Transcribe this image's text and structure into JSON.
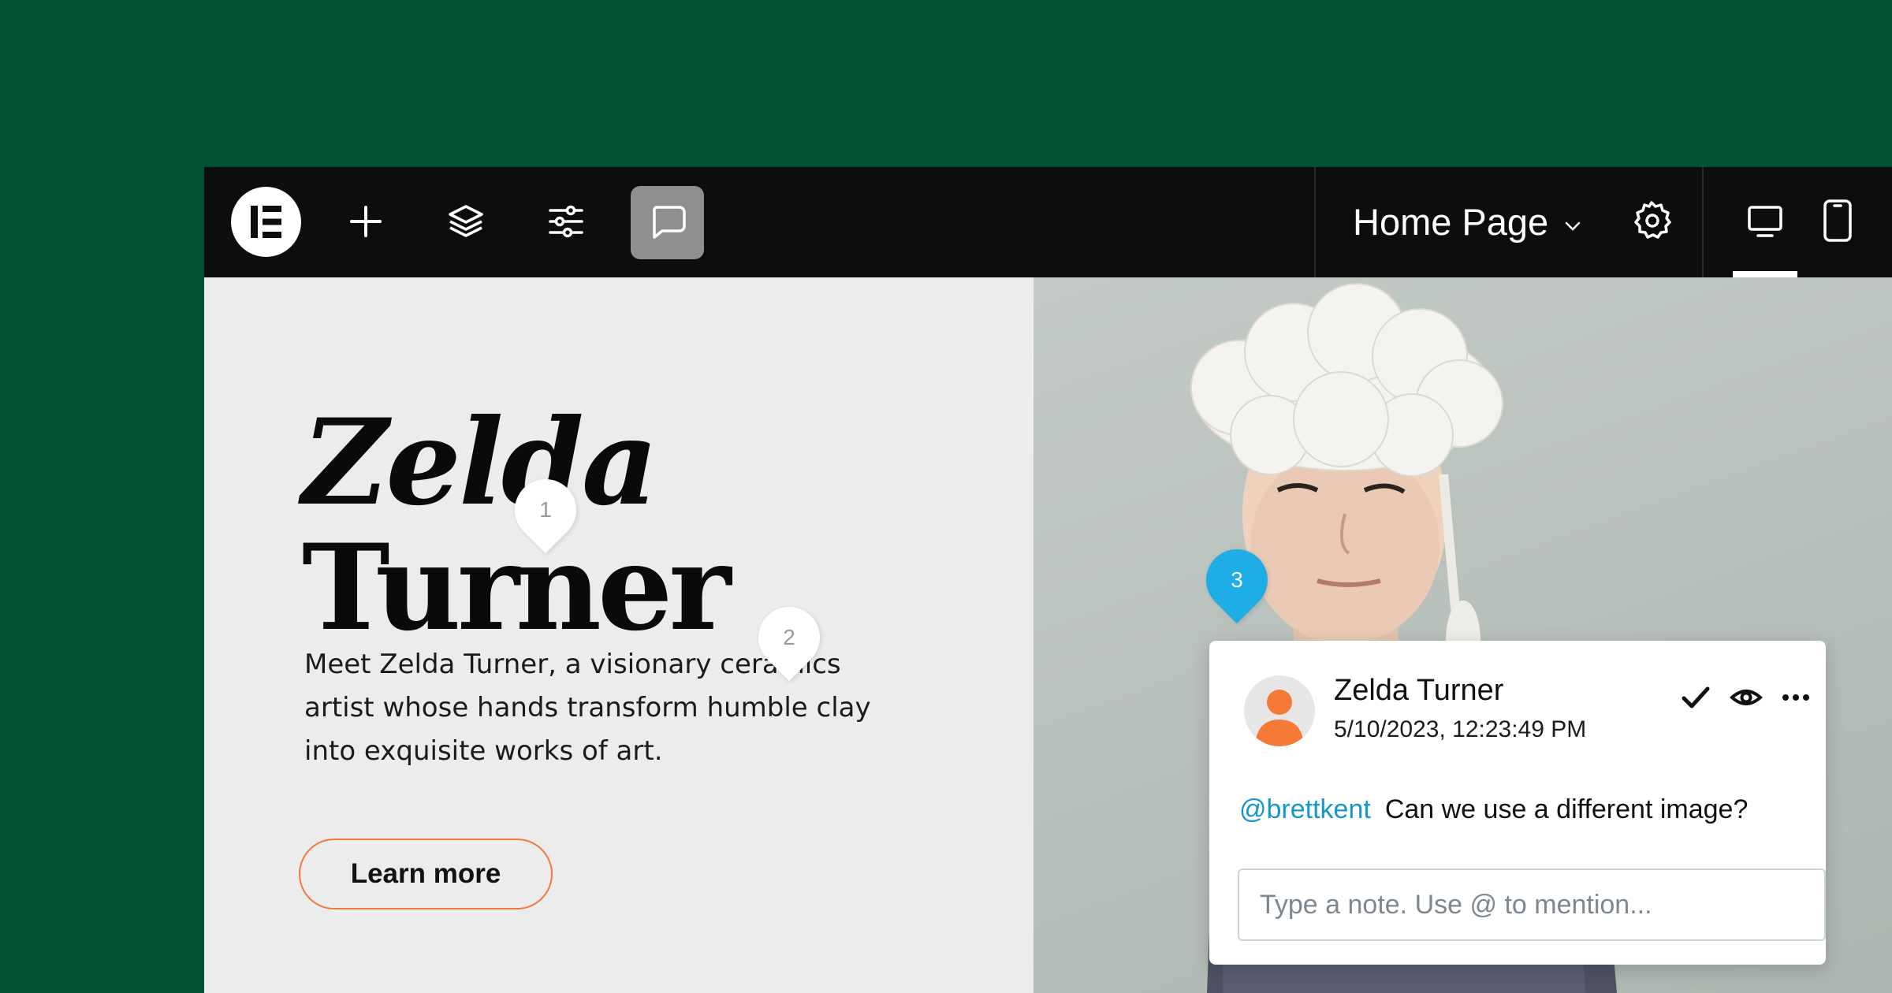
{
  "colors": {
    "background": "#005032",
    "topbar": "#0c0d0e",
    "active_tool": "#8e8f91",
    "button_border": "#f07a3c",
    "mention": "#1598c9",
    "pin_blue": "#1eaee5",
    "avatar": "#f47a35"
  },
  "topbar": {
    "logo_icon": "elementor-logo-icon",
    "tools": [
      {
        "name": "add-icon"
      },
      {
        "name": "layers-icon"
      },
      {
        "name": "settings-sliders-icon"
      },
      {
        "name": "comments-icon",
        "active": true
      }
    ],
    "page_title": "Home Page",
    "page_dropdown_icon": "chevron-down-icon",
    "settings_icon": "gear-icon",
    "devices": [
      {
        "name": "desktop-icon",
        "active": true
      },
      {
        "name": "mobile-icon",
        "active": false
      }
    ]
  },
  "hero": {
    "title_line1": "Zelda",
    "title_line2": "Turner",
    "intro_line1": "Meet Zelda Turner, a visionary ceramics",
    "intro_line2": "artist whose hands transform humble clay",
    "intro_line3": "into exquisite works of art.",
    "cta_label": "Learn more"
  },
  "pins": [
    {
      "label": "1",
      "style": "white"
    },
    {
      "label": "2",
      "style": "white"
    },
    {
      "label": "3",
      "style": "blue"
    }
  ],
  "comment": {
    "author": "Zelda Turner",
    "timestamp": "5/10/2023, 12:23:49 PM",
    "mention": "@brettkent",
    "text": "Can we use a different image?",
    "input_placeholder": "Type a note. Use @ to mention...",
    "actions": [
      "check-icon",
      "eye-icon",
      "more-icon"
    ]
  }
}
